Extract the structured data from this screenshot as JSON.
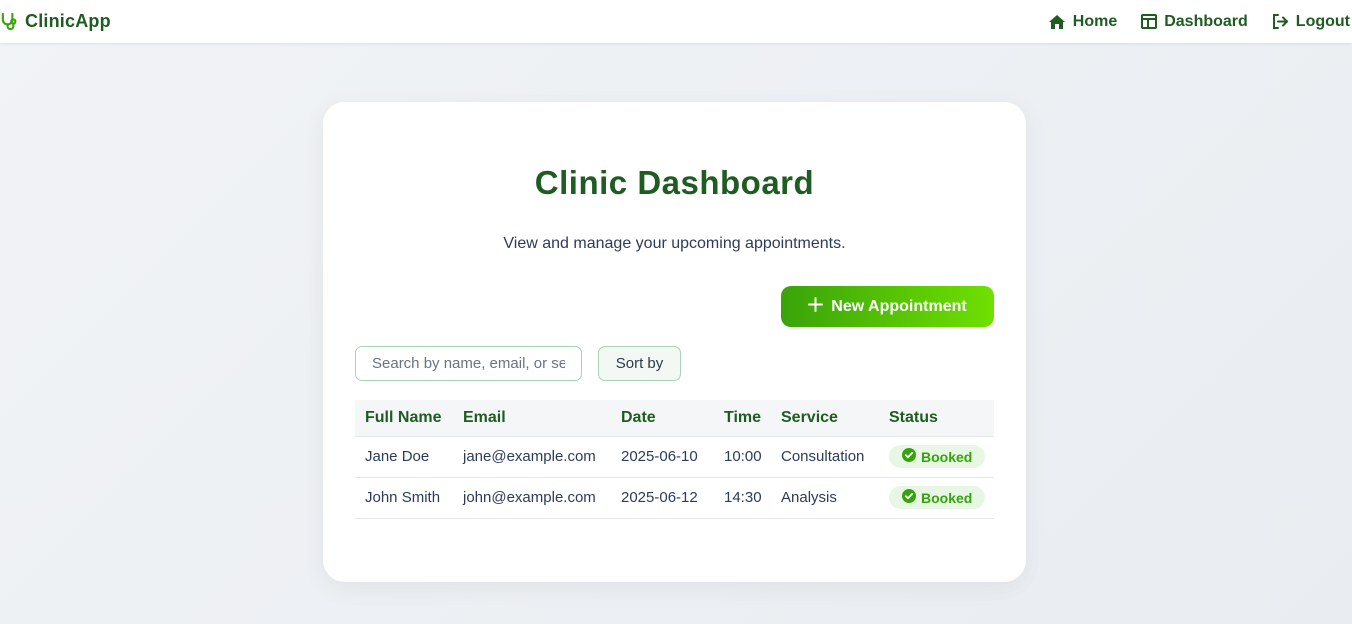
{
  "app": {
    "brand": "ClinicApp"
  },
  "nav": {
    "items": [
      {
        "label": "Home",
        "icon": "home-icon"
      },
      {
        "label": "Dashboard",
        "icon": "dashboard-icon"
      },
      {
        "label": "Logout",
        "icon": "logout-icon"
      }
    ]
  },
  "page": {
    "title": "Clinic Dashboard",
    "subtitle": "View and manage your upcoming appointments.",
    "new_button": "New Appointment",
    "search_placeholder": "Search by name, email, or service",
    "sort_label": "Sort by"
  },
  "table": {
    "headers": [
      "Full Name",
      "Email",
      "Date",
      "Time",
      "Service",
      "Status"
    ],
    "rows": [
      {
        "name": "Jane Doe",
        "email": "jane@example.com",
        "date": "2025-06-10",
        "time": "10:00",
        "service": "Consultation",
        "status": "Booked"
      },
      {
        "name": "John Smith",
        "email": "john@example.com",
        "date": "2025-06-12",
        "time": "14:30",
        "service": "Analysis",
        "status": "Booked"
      }
    ]
  },
  "colors": {
    "brand": "#1f5c22",
    "accent_start": "#3aa30a",
    "accent_end": "#6fe000",
    "status_booked": "#36a30e"
  }
}
